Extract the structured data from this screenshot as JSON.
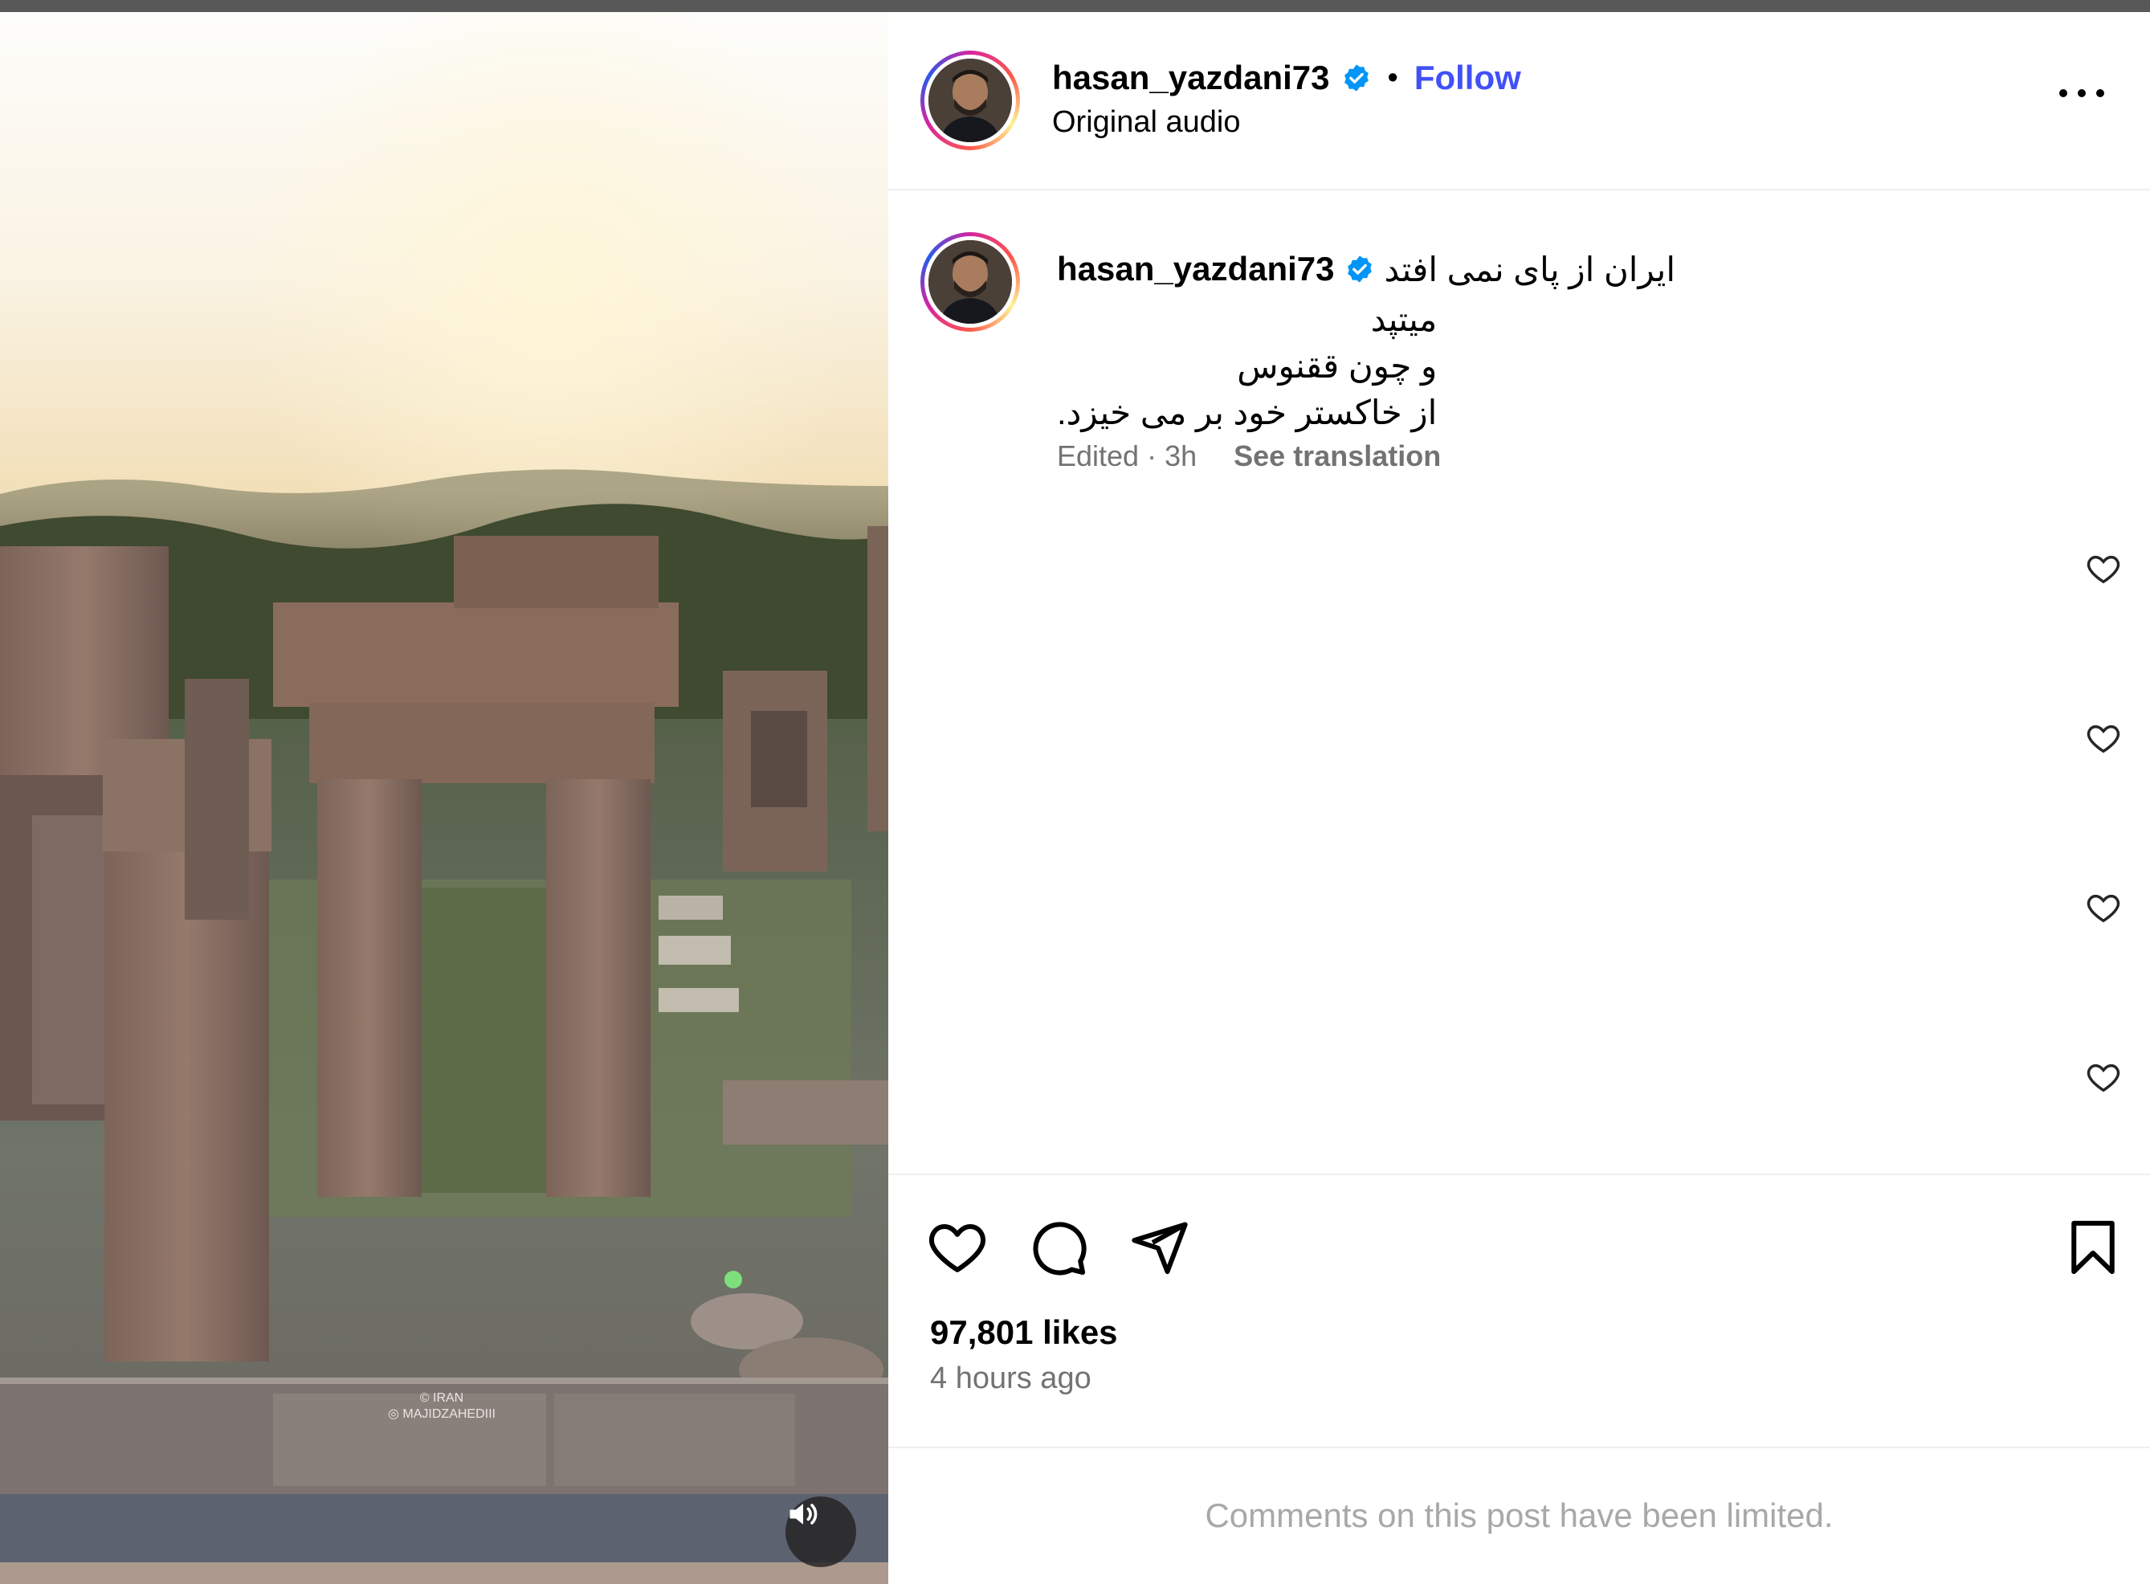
{
  "media": {
    "watermark_line1": "IRAN",
    "watermark_line2": "MAJIDZAHEDIII",
    "mute_icon": "speaker-volume-icon"
  },
  "post": {
    "username": "hasan_yazdani73",
    "verified": true,
    "separator": "•",
    "follow_label": "Follow",
    "audio_label": "Original audio",
    "more_icon": "more-options-icon"
  },
  "caption": {
    "username": "hasan_yazdani73",
    "line1": "ایران از پای نمی افتد",
    "lines": [
      "میتپد",
      "و چون ققنوس",
      "از خاکستر خود بر می خیزد."
    ],
    "edited_label": "Edited · 3h",
    "see_translation_label": "See translation"
  },
  "engagement": {
    "likes_label": "97,801 likes",
    "time_label": "4 hours ago"
  },
  "comments": {
    "limited_label": "Comments on this post have been limited."
  },
  "colors": {
    "follow": "#4150f7",
    "verified": "#0095f6",
    "muted_text": "#737373"
  }
}
